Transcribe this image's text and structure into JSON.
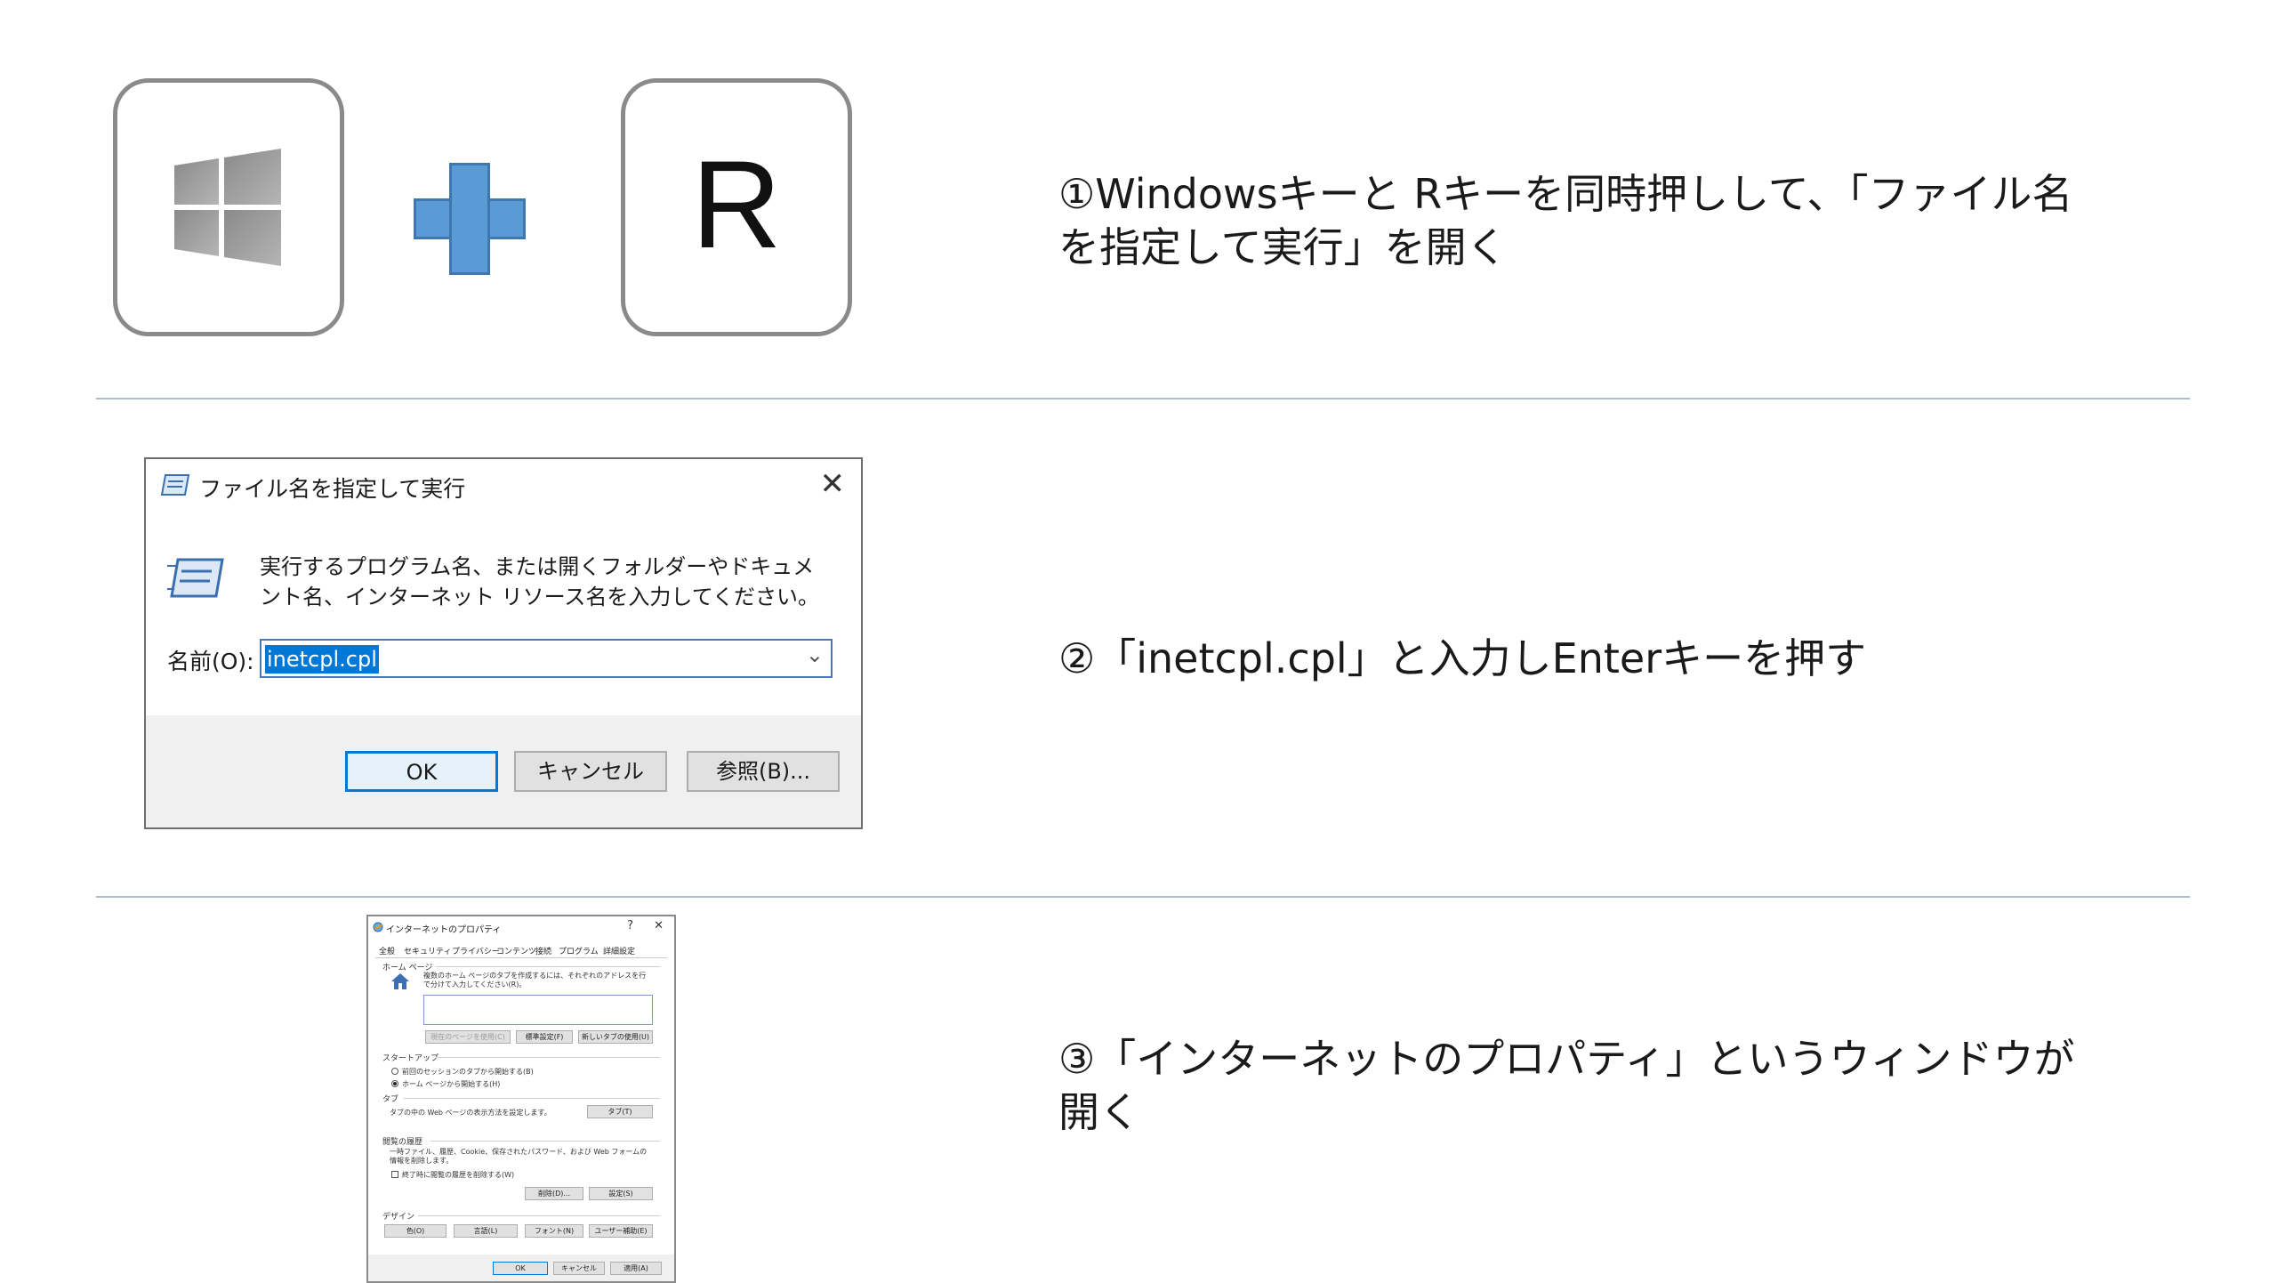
{
  "steps": [
    {
      "text": "①Windowsキーと Rキーを同時押しして、「ファイル名\nを指定して実行」を開く"
    },
    {
      "text": "②「inetcpl.cpl」と入力しEnterキーを押す"
    },
    {
      "text": "③「インターネットのプロパティ」というウィンドウが\n開く"
    }
  ],
  "keys": {
    "r_key": "R"
  },
  "colors": {
    "plus": "#5b9bd5",
    "divider": "#a9bed0",
    "selection": "#0078d7",
    "keycap_border": "#8a8a8a"
  },
  "run_dialog": {
    "title": "ファイル名を指定して実行",
    "description": "実行するプログラム名、または開くフォルダーやドキュメント名、インターネット リソース名を入力してください。",
    "name_label": "名前(O):",
    "input_value": "inetcpl.cpl",
    "ok": "OK",
    "cancel": "キャンセル",
    "browse": "参照(B)..."
  },
  "internet_properties": {
    "title": "インターネットのプロパティ",
    "help": "?",
    "close": "✕",
    "tabs": [
      "全般",
      "セキュリティ",
      "プライバシー",
      "コンテンツ",
      "接続",
      "プログラム",
      "詳細設定"
    ],
    "homepage_section": "ホーム ページ",
    "homepage_desc": "複数のホーム ページのタブを作成するには、それぞれのアドレスを行で分けて入力してください(R)。",
    "homepage_value": "",
    "btn_use_current": "現在のページを使用(C)",
    "btn_use_default": "標準設定(F)",
    "btn_use_newtab": "新しいタブの使用(U)",
    "startup_section": "スタートアップ",
    "startup_prev": "前回のセッションのタブから開始する(B)",
    "startup_home": "ホーム ページから開始する(H)",
    "tabs_section": "タブ",
    "tabs_desc": "タブの中の Web ページの表示方法を設定します。",
    "btn_tabs": "タブ(T)",
    "history_section": "閲覧の履歴",
    "history_desc": "一時ファイル、履歴、Cookie、保存されたパスワード、および Web フォームの情報を削除します。",
    "history_check": "終了時に閲覧の履歴を削除する(W)",
    "btn_delete": "削除(D)...",
    "btn_settings": "設定(S)",
    "design_section": "デザイン",
    "btn_color": "色(O)",
    "btn_language": "言語(L)",
    "btn_font": "フォント(N)",
    "btn_accessibility": "ユーザー補助(E)",
    "btn_ok": "OK",
    "btn_cancel": "キャンセル",
    "btn_apply": "適用(A)"
  }
}
